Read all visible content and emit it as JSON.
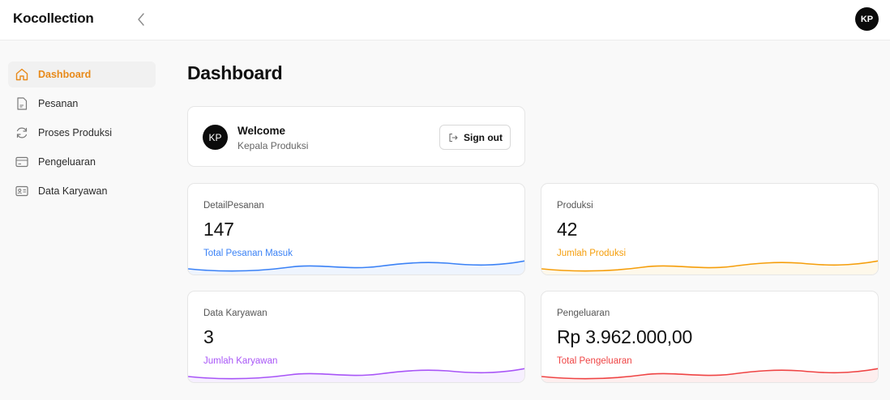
{
  "app": {
    "brand": "Kocollection",
    "user_initials": "KP"
  },
  "sidebar": {
    "items": [
      {
        "label": "Dashboard",
        "icon": "home-icon",
        "active": true
      },
      {
        "label": "Pesanan",
        "icon": "document-icon",
        "active": false
      },
      {
        "label": "Proses Produksi",
        "icon": "refresh-icon",
        "active": false
      },
      {
        "label": "Pengeluaran",
        "icon": "credit-card-icon",
        "active": false
      },
      {
        "label": "Data Karyawan",
        "icon": "id-card-icon",
        "active": false
      }
    ]
  },
  "page": {
    "title": "Dashboard"
  },
  "welcome": {
    "avatar_initials": "KP",
    "title": "Welcome",
    "role": "Kepala Produksi",
    "signout_label": "Sign out"
  },
  "stats": [
    {
      "title": "DetailPesanan",
      "value": "147",
      "subtitle": "Total Pesanan Masuk",
      "color": "#3b82f6",
      "fill": "#eef4fe"
    },
    {
      "title": "Produksi",
      "value": "42",
      "subtitle": "Jumlah Produksi",
      "color": "#f59e0b",
      "fill": "#fef8ea"
    },
    {
      "title": "Data Karyawan",
      "value": "3",
      "subtitle": "Jumlah Karyawan",
      "color": "#a855f7",
      "fill": "#f6efff"
    },
    {
      "title": "Pengeluaran",
      "value": "Rp 3.962.000,00",
      "subtitle": "Total Pengeluaran",
      "color": "#ef4444",
      "fill": "#fdeeee"
    }
  ],
  "colors": {
    "accent": "#e88a1a",
    "dark": "#0b0b0b"
  }
}
